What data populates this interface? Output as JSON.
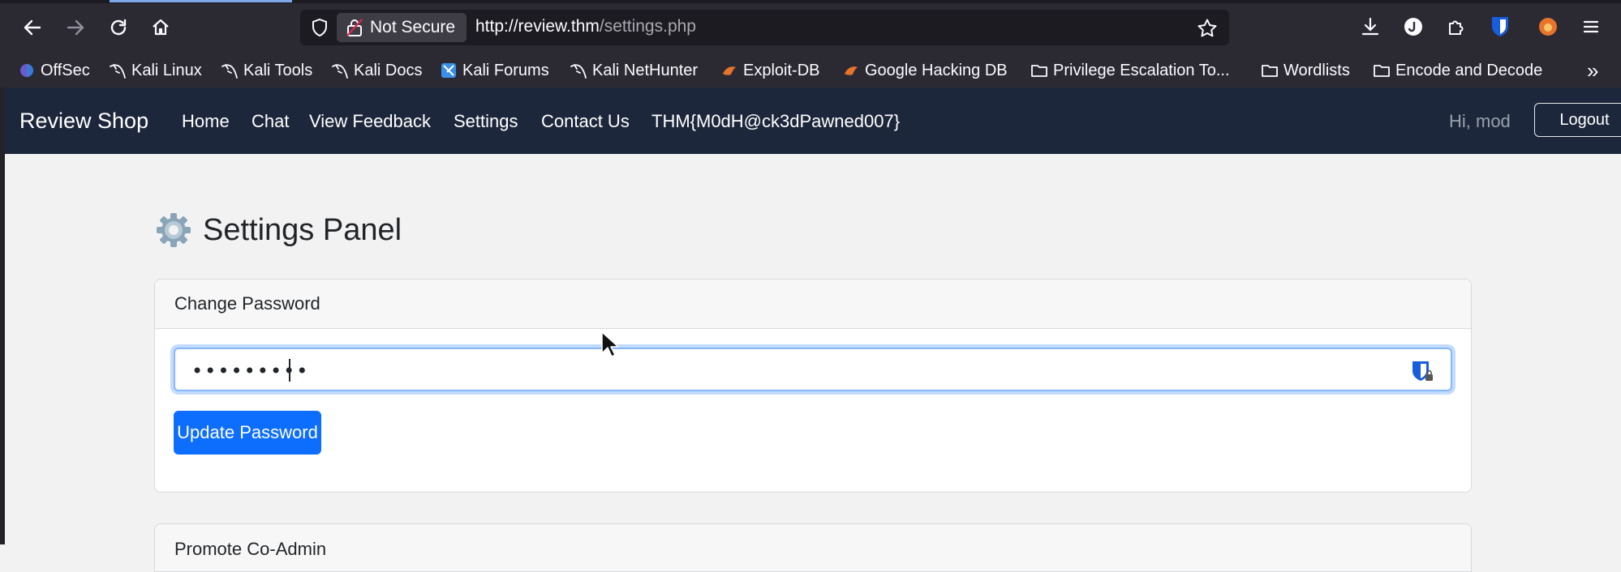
{
  "browser": {
    "security_label": "Not Secure",
    "url_host": "http://review.thm",
    "url_path": "/settings.php",
    "bookmarks": [
      {
        "label": "OffSec",
        "icon": "offsec-icon"
      },
      {
        "label": "Kali Linux",
        "icon": "kali-dragon-icon"
      },
      {
        "label": "Kali Tools",
        "icon": "kali-dragon-icon"
      },
      {
        "label": "Kali Docs",
        "icon": "kali-dragon-icon"
      },
      {
        "label": "Kali Forums",
        "icon": "kali-forums-icon"
      },
      {
        "label": "Kali NetHunter",
        "icon": "kali-dragon-icon"
      },
      {
        "label": "Exploit-DB",
        "icon": "exploitdb-icon"
      },
      {
        "label": "Google Hacking DB",
        "icon": "exploitdb-icon"
      },
      {
        "label": "Privilege Escalation To...",
        "icon": "folder-icon"
      },
      {
        "label": "Wordlists",
        "icon": "folder-icon"
      },
      {
        "label": "Encode and Decode",
        "icon": "folder-icon"
      }
    ],
    "overflow": "»"
  },
  "navbar": {
    "brand": "Review Shop",
    "links": [
      "Home",
      "Chat",
      "View Feedback",
      "Settings",
      "Contact Us",
      "THM{M0dH@ck3dPawned007}"
    ],
    "greeting": "Hi, mod",
    "logout_label": "Logout"
  },
  "page": {
    "title": "Settings Panel",
    "change_password": {
      "header": "Change Password",
      "password_value": "•••••••••",
      "button_label": "Update Password"
    },
    "second_card_header": "Promote Co-Admin"
  },
  "colors": {
    "navbar_bg": "#1d273b",
    "primary": "#0d6efd",
    "chrome_bg": "#2b2a33"
  }
}
